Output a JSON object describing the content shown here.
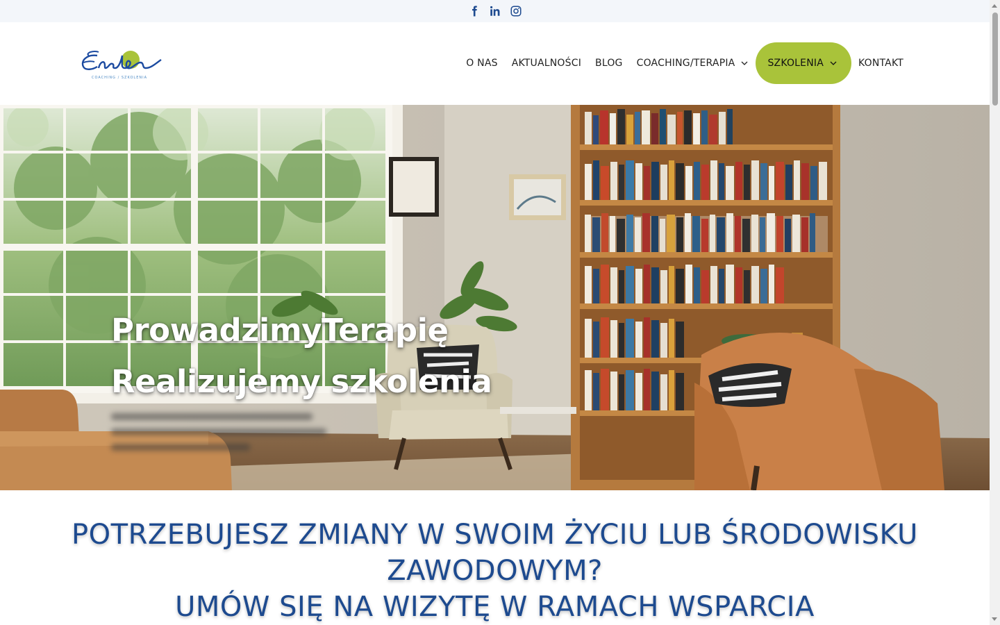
{
  "social": [
    {
      "name": "facebook-icon",
      "icon": "facebook"
    },
    {
      "name": "linkedin-icon",
      "icon": "linkedin"
    },
    {
      "name": "instagram-icon",
      "icon": "instagram"
    }
  ],
  "brand": {
    "logo_text": "Eneba",
    "logo_tagline": "COACHING / SZKOLENIA",
    "colors": {
      "primary": "#1d4a8f",
      "accent": "#a9c33a",
      "logo_blue": "#1b4aa0",
      "logo_green": "#a9c33a"
    }
  },
  "nav": {
    "items": [
      {
        "label": "O NAS"
      },
      {
        "label": "AKTUALNOŚCI"
      },
      {
        "label": "BLOG"
      },
      {
        "label": "COACHING/TERAPIA",
        "has_dropdown": true
      },
      {
        "label": "SZKOLENIA",
        "has_dropdown": true,
        "active": true
      },
      {
        "label": "KONTAKT"
      }
    ]
  },
  "hero": {
    "title_line1": "ProwadzimyTerapię",
    "title_line2": "Realizujemy szkolenia"
  },
  "headline": {
    "line1": "POTRZEBUJESZ ZMIANY W SWOIM ŻYCIU LUB ŚRODOWISKU",
    "line2": "ZAWODOWYM?",
    "line3": "UMÓW SIĘ NA WIZYTĘ W RAMACH WSPARCIA"
  }
}
